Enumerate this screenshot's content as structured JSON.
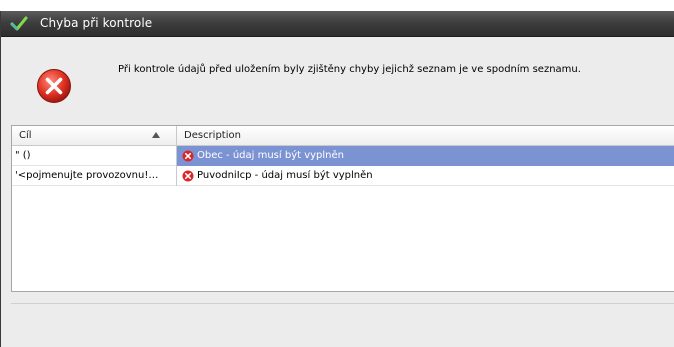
{
  "window": {
    "title": "Chyba při kontrole"
  },
  "message": "Při kontrole údajů před uložením byly zjištěny chyby jejichž seznam je ve spodním seznamu.",
  "grid": {
    "columns": [
      "Cíl",
      "Description"
    ],
    "sort_column": "Cíl",
    "sort_direction": "ascending",
    "rows": [
      {
        "target": "\" ()",
        "description": "Obec - údaj musí být vyplněn",
        "selected": true
      },
      {
        "target": "'<pojmenujte provozovnu!…",
        "description": "PuvodniIcp - údaj musí být vyplněn",
        "selected": false
      }
    ]
  },
  "colors": {
    "title_bar": "#3e3e3e",
    "selection": "#7c93d3",
    "error_red": "#d9262b"
  }
}
